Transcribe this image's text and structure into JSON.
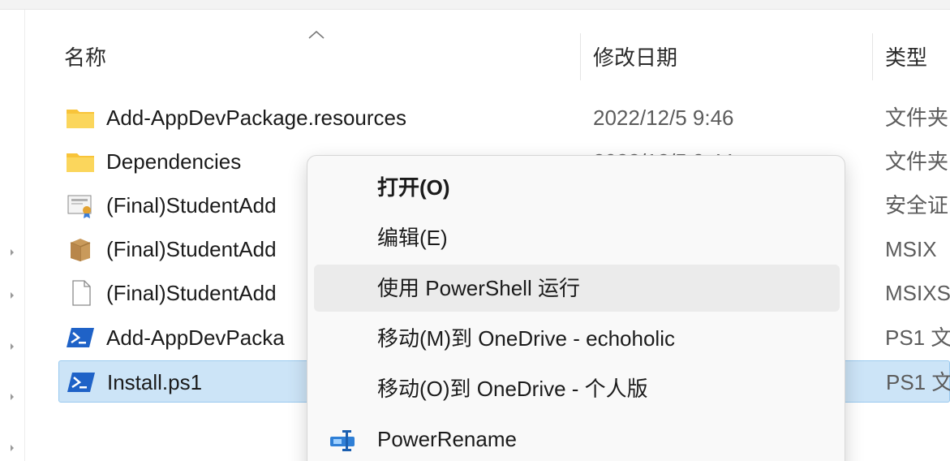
{
  "columns": {
    "name": "名称",
    "modified": "修改日期",
    "type": "类型"
  },
  "files": [
    {
      "icon": "folder-icon",
      "name": "Add-AppDevPackage.resources",
      "date": "2022/12/5 9:46",
      "type": "文件夹",
      "selected": false
    },
    {
      "icon": "folder-icon",
      "name": "Dependencies",
      "date": "2022/12/5 9:44",
      "type": "文件夹",
      "selected": false
    },
    {
      "icon": "certificate-icon",
      "name": "(Final)StudentAdd",
      "date": "",
      "type": "安全证",
      "selected": false
    },
    {
      "icon": "package-box-icon",
      "name": "(Final)StudentAdd",
      "date": "",
      "type": "MSIX",
      "selected": false
    },
    {
      "icon": "blank-file-icon",
      "name": "(Final)StudentAdd",
      "date": "",
      "type": "MSIXS",
      "selected": false
    },
    {
      "icon": "powershell-icon",
      "name": "Add-AppDevPacka",
      "date": "",
      "type": "PS1 文",
      "selected": false
    },
    {
      "icon": "powershell-icon",
      "name": "Install.ps1",
      "date": "",
      "type": "PS1 文",
      "selected": true
    }
  ],
  "context_menu": {
    "items": [
      {
        "label": "打开(O)",
        "bold": true,
        "icon": ""
      },
      {
        "label": "编辑(E)",
        "bold": false,
        "icon": ""
      },
      {
        "label": "使用 PowerShell 运行",
        "bold": false,
        "icon": "",
        "hover": true
      },
      {
        "label": "移动(M)到 OneDrive - echoholic",
        "bold": false,
        "icon": ""
      },
      {
        "label": "移动(O)到 OneDrive - 个人版",
        "bold": false,
        "icon": ""
      },
      {
        "label": "PowerRename",
        "bold": false,
        "icon": "power-rename-icon"
      }
    ]
  },
  "colors": {
    "selection": "#cce4f7",
    "selection_border": "#99c9ef",
    "menu_hover": "#ebebeb",
    "powershell": "#1f62c7",
    "folder": "#f8c43a"
  }
}
